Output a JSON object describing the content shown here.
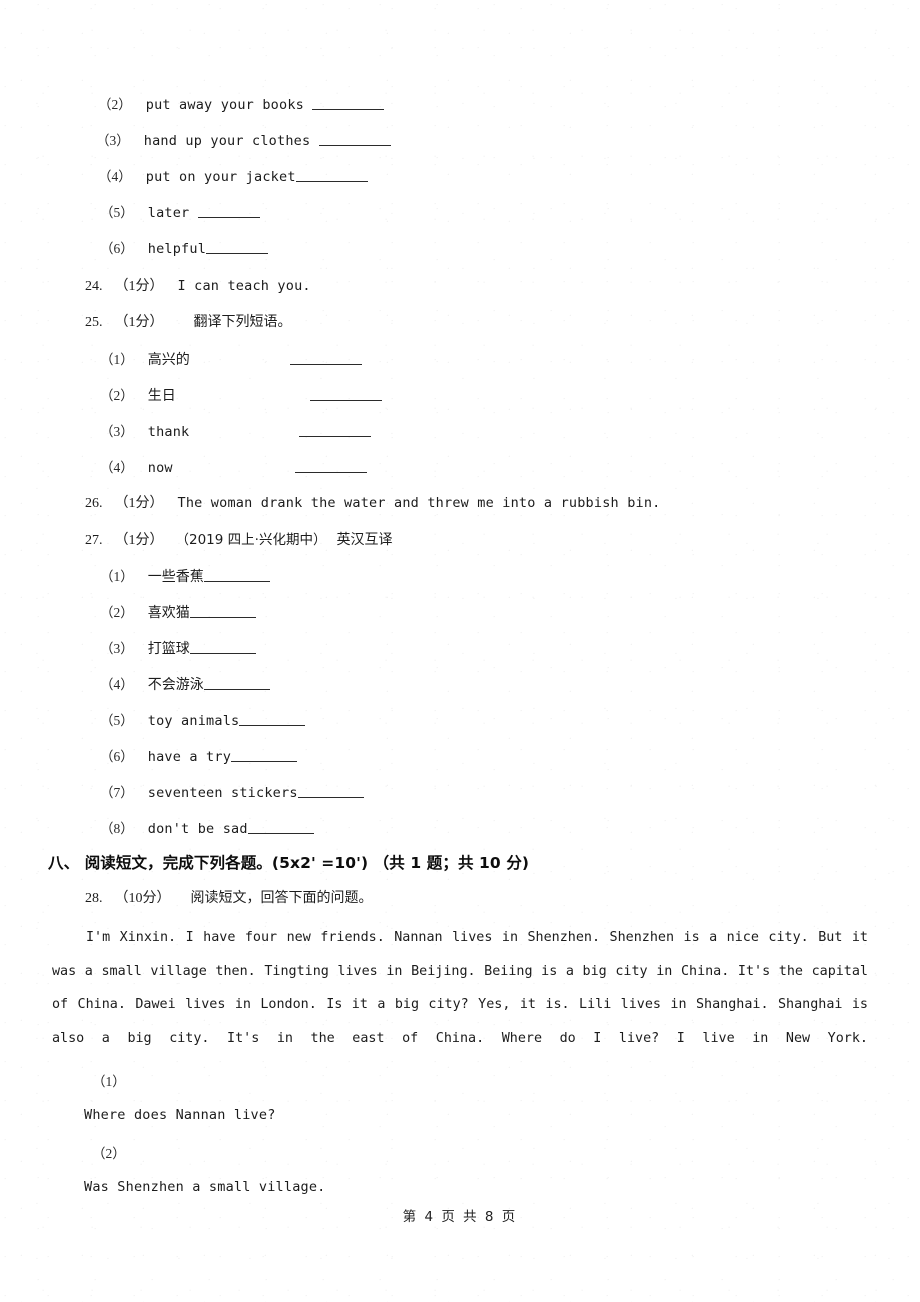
{
  "page": {
    "footer": "第 4 页 共 8 页",
    "page_number": "4",
    "total_pages": "8"
  },
  "continued_items": {
    "items": [
      {
        "marker": "（2）",
        "text": "put away your books ",
        "blank": true,
        "blank_width": 72
      },
      {
        "marker": "（3）",
        "text": "hand up your clothes ",
        "blank": true,
        "blank_width": 72
      },
      {
        "marker": "（4）",
        "text": "put on your jacket",
        "blank": true,
        "blank_width": 72
      },
      {
        "marker": "（5）",
        "text": "later ",
        "blank": true,
        "blank_width": 62
      },
      {
        "marker": "（6）",
        "text": "helpful",
        "blank": true,
        "blank_width": 62
      }
    ]
  },
  "questions": [
    {
      "number": "24.",
      "score": "（1分）",
      "prompt": "I can teach you.",
      "prompt_lang": "en"
    },
    {
      "number": "25.",
      "score": "（1分）",
      "prompt": "翻译下列短语。",
      "prompt_lang": "cn",
      "subitems": [
        {
          "marker": "（1）",
          "text": "高兴的",
          "lang": "cn",
          "gap": 96,
          "blank_width": 72
        },
        {
          "marker": "（2）",
          "text": "生日",
          "lang": "cn",
          "gap": 118,
          "blank_width": 72
        },
        {
          "marker": "（3）",
          "text": "thank",
          "lang": "en",
          "gap": 106,
          "blank_width": 72
        },
        {
          "marker": "（4）",
          "text": "now",
          "lang": "en",
          "gap": 118,
          "blank_width": 72
        }
      ]
    },
    {
      "number": "26.",
      "score": "（1分）",
      "prompt": "The woman drank the water and threw me into a rubbish bin.",
      "prompt_lang": "en"
    },
    {
      "number": "27.",
      "score": "（1分）",
      "source": "（2019 四上·兴化期中）",
      "prompt": "英汉互译",
      "prompt_lang": "cn",
      "subitems": [
        {
          "marker": "（1）",
          "text": "一些香蕉",
          "lang": "cn",
          "gap": 0,
          "blank_width": 66
        },
        {
          "marker": "（2）",
          "text": "喜欢猫",
          "lang": "cn",
          "gap": 0,
          "blank_width": 66
        },
        {
          "marker": "（3）",
          "text": "打篮球",
          "lang": "cn",
          "gap": 0,
          "blank_width": 66
        },
        {
          "marker": "（4）",
          "text": "不会游泳",
          "lang": "cn",
          "gap": 0,
          "blank_width": 66
        },
        {
          "marker": "（5）",
          "text": "toy animals",
          "lang": "en",
          "gap": 0,
          "blank_width": 66
        },
        {
          "marker": "（6）",
          "text": "have a try",
          "lang": "en",
          "gap": 0,
          "blank_width": 66
        },
        {
          "marker": "（7）",
          "text": "seventeen stickers",
          "lang": "en",
          "gap": 0,
          "blank_width": 66
        },
        {
          "marker": "（8）",
          "text": "don't be sad",
          "lang": "en",
          "gap": 0,
          "blank_width": 66
        }
      ]
    }
  ],
  "section_eight": {
    "heading": "八、 阅读短文，完成下列各题。(5x2' =10')  （共 1 题；共 10 分)",
    "question": {
      "number": "28.",
      "score": "（10分）",
      "prompt": "阅读短文，回答下面的问题。"
    },
    "passage": "I'm Xinxin. I have four new friends. Nannan lives in Shenzhen. Shenzhen is a nice city. But it was a small village then. Tingting lives in Beijing. Beiing is a big city in China. It's the capital of China. Dawei lives in London. Is it a big city? Yes, it is. Lili lives in Shanghai. Shanghai is also a big city. It's in the east of China. Where do I live? I live in New York.",
    "subquestions": [
      {
        "marker": "（1）",
        "text": "Where does Nannan live?"
      },
      {
        "marker": "（2）",
        "text": "Was Shenzhen a small village."
      }
    ]
  }
}
